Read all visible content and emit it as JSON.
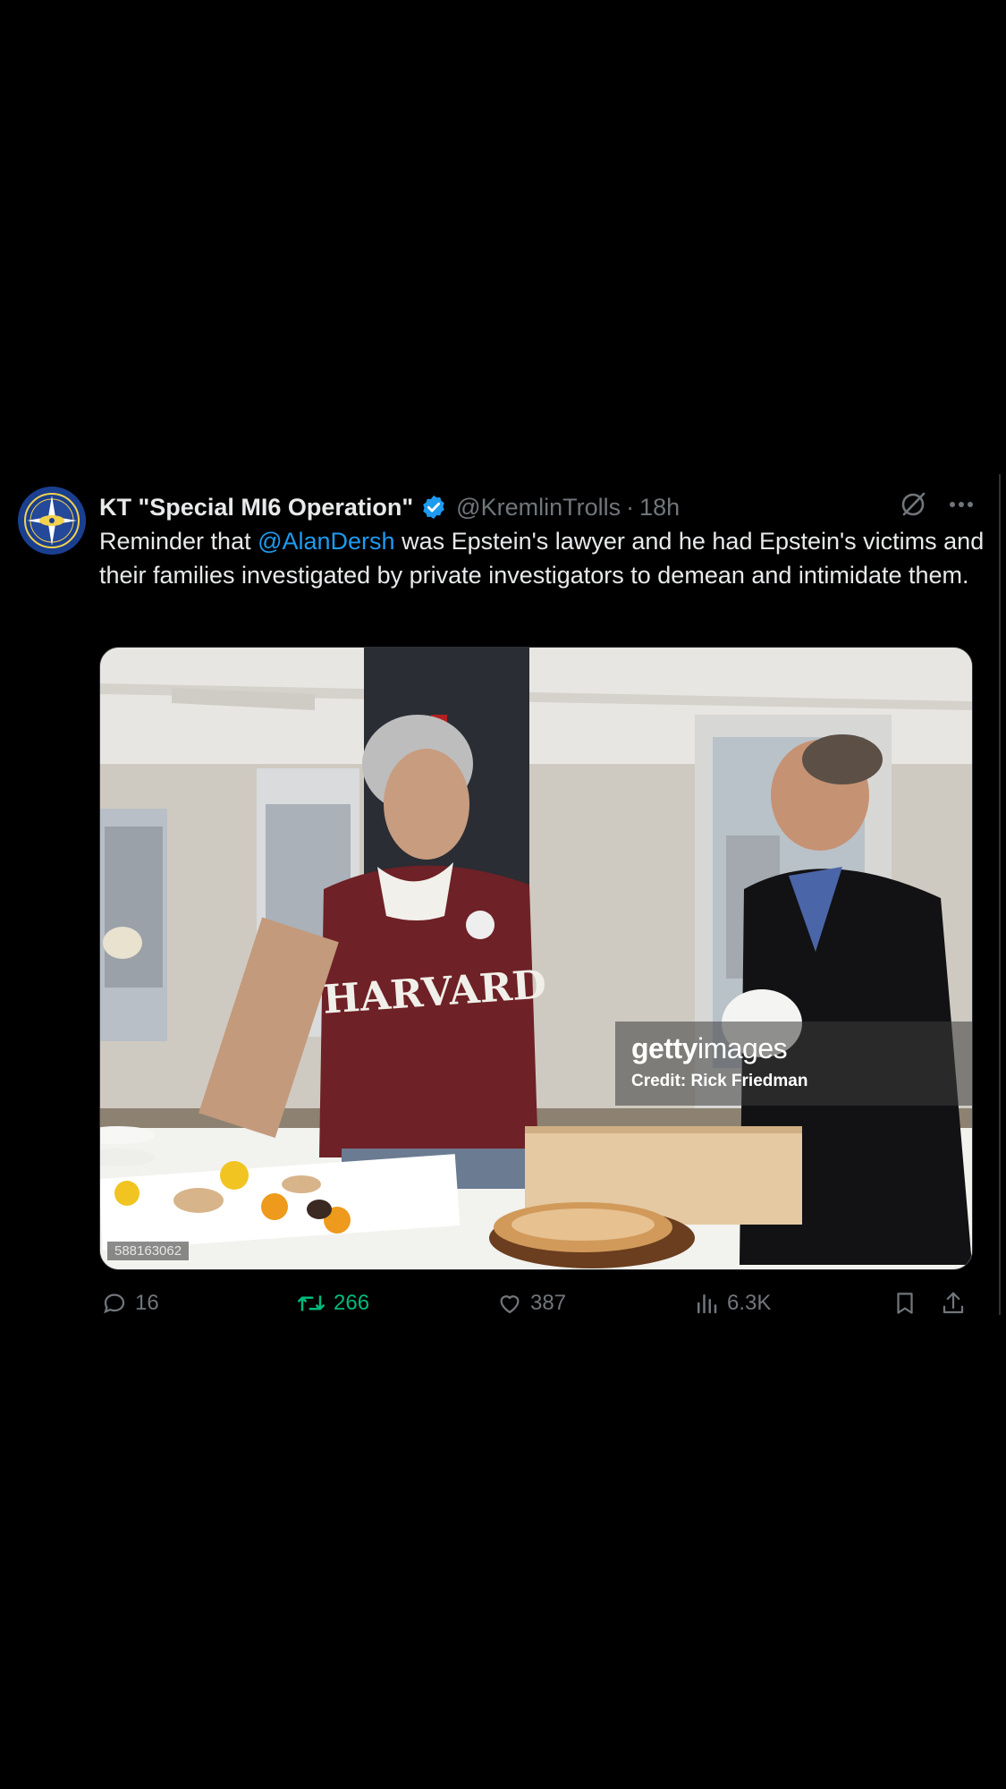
{
  "tweet": {
    "display_name": "KT \"Special MI6 Operation\"",
    "handle": "@KremlinTrolls",
    "separator": "·",
    "time": "18h",
    "text_before": "Reminder that ",
    "mention": "@AlanDersh",
    "text_after": " was Epstein's lawyer and he had Epstein's victims and their families investigated by private investigators to demean and intimidate them.",
    "media": {
      "watermark_brand_bold": "getty",
      "watermark_brand_light": "images",
      "watermark_credit": "Credit: Rick Friedman",
      "sweatshirt_text": "HARVARD",
      "image_id": "588163062"
    },
    "actions": {
      "replies": "16",
      "retweets": "266",
      "likes": "387",
      "views": "6.3K"
    }
  },
  "colors": {
    "background": "#000000",
    "text": "#e7e9ea",
    "secondary": "#71767b",
    "link": "#1d9bf0",
    "retweet": "#00ba7c",
    "verified": "#1d9bf0"
  },
  "icons": [
    "avatar-emblem",
    "verified-badge-icon",
    "grok-icon",
    "more-icon",
    "reply-icon",
    "retweet-icon",
    "like-icon",
    "views-icon",
    "bookmark-icon",
    "share-icon"
  ]
}
